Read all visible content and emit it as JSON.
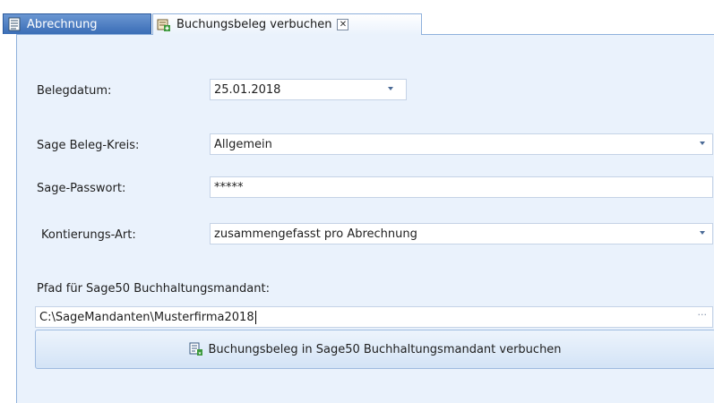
{
  "tabs": [
    {
      "label": "Abrechnung",
      "icon": "document-list-icon",
      "active": false
    },
    {
      "label": "Buchungsbeleg verbuchen",
      "icon": "booking-add-icon",
      "active": true,
      "close_label": "✕"
    }
  ],
  "form": {
    "belegdatum": {
      "label": "Belegdatum:",
      "value": "25.01.2018"
    },
    "belegkreis": {
      "label": "Sage Beleg-Kreis:",
      "value": "Allgemein"
    },
    "passwort": {
      "label": "Sage-Passwort:",
      "value": "*****"
    },
    "kontierung": {
      "label": "Kontierungs-Art:",
      "value": "zusammengefasst pro Abrechnung"
    },
    "pfad": {
      "label": "Pfad für Sage50 Buchhaltungsmandant:",
      "value": "C:\\SageMandanten\\Musterfirma2018",
      "browse": "···"
    }
  },
  "action": {
    "label": "Buchungsbeleg in Sage50 Buchhaltungsmandant verbuchen",
    "icon": "post-booking-icon"
  },
  "colors": {
    "panel_bg": "#eaf2fc",
    "tab_inactive": "#3a6db6",
    "border": "#8fb1dc"
  }
}
